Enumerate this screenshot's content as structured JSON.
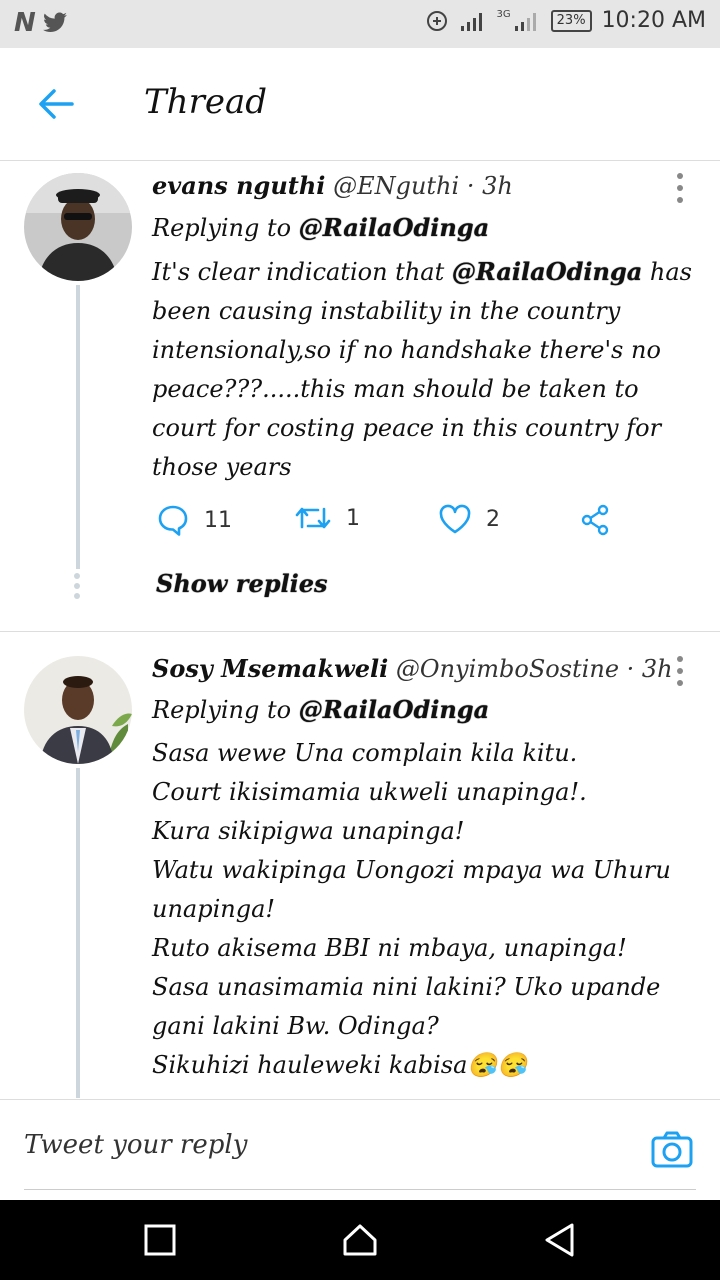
{
  "status_bar": {
    "time": "10:20 AM",
    "battery": "23%",
    "network": "3G",
    "apps": "N"
  },
  "header": {
    "title": "Thread"
  },
  "tweets": [
    {
      "name": "evans nguthi",
      "handle": "@ENguthi",
      "time": "· 3h",
      "replying_prefix": "Replying to",
      "replying_to": "@RailaOdinga",
      "body_prefix": "It's clear indication that ",
      "body_mention": "@RailaOdinga",
      "body_rest": " has been causing instability in the country intensionaly,so if no handshake there's no peace???.....this man should be taken to court for costing peace in this country for those years",
      "replies": "11",
      "retweets": "1",
      "likes": "2",
      "show_replies": "Show replies"
    },
    {
      "name": "Sosy Msemakweli",
      "handle": "@OnyimboSostine",
      "time": "· 3h",
      "replying_prefix": "Replying to",
      "replying_to": "@RailaOdinga",
      "body": "Sasa wewe Una complain kila kitu.\nCourt ikisimamia ukweli unapinga!.\nKura sikipigwa unapinga!\nWatu wakipinga Uongozi mpaya wa Uhuru unapinga!\nRuto akisema BBI ni mbaya, unapinga!\nSasa unasimamia nini lakini? Uko upande gani lakini Bw. Odinga?\nSikuhizi hauleweki kabisa😪😪"
    }
  ],
  "reply_bar": {
    "placeholder": "Tweet your reply"
  },
  "colors": {
    "accent": "#1da1f2",
    "divider": "#dddddd",
    "thread_line": "#cdd6dd"
  }
}
